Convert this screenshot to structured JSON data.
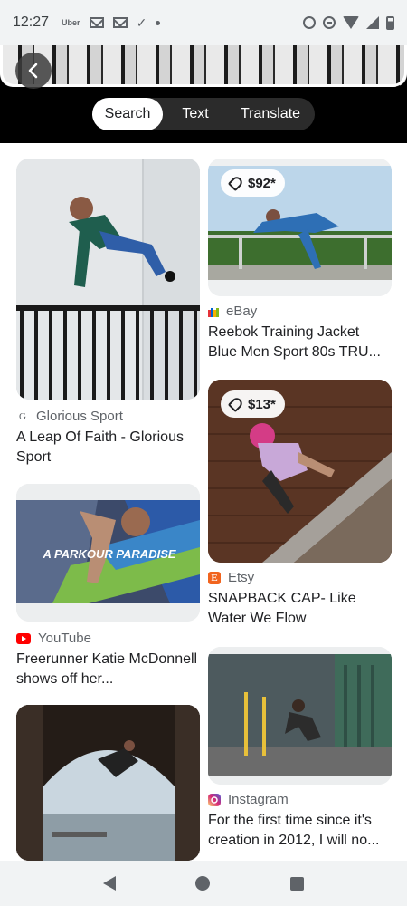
{
  "status_bar": {
    "time": "12:27",
    "uber_label": "Uber",
    "check_glyph": "✓",
    "icons_left": [
      "uber-icon",
      "gmail-icon",
      "gmail-icon",
      "task-check-icon",
      "dot-icon"
    ],
    "icons_right": [
      "alarm-icon",
      "do-not-disturb-icon",
      "wifi-icon",
      "signal-icon",
      "battery-icon"
    ]
  },
  "header": {
    "back_icon": "chevron-left-icon",
    "modes": [
      {
        "label": "Search",
        "active": true
      },
      {
        "label": "Text",
        "active": false
      },
      {
        "label": "Translate",
        "active": false
      }
    ]
  },
  "results": {
    "left": [
      {
        "source": "Glorious Sport",
        "source_icon": "G",
        "title": "A Leap Of Faith - Glorious Sport"
      },
      {
        "source": "YouTube",
        "source_icon": "youtube-icon",
        "overlay_text": "A PARKOUR PARADISE",
        "title": "Freerunner Katie McDonnell shows off her..."
      },
      {
        "source": "",
        "title": ""
      }
    ],
    "right": [
      {
        "price": "$92*",
        "source": "eBay",
        "source_icon": "ebay-icon",
        "title": "Reebok Training Jacket Blue Men Sport 80s TRU..."
      },
      {
        "price": "$13*",
        "source": "Etsy",
        "source_icon": "E",
        "title": "SNAPBACK CAP- Like Water We Flow"
      },
      {
        "source": "Instagram",
        "source_icon": "instagram-icon",
        "title": "For the first time since it's creation in 2012, I will no..."
      }
    ]
  },
  "nav_bar": {
    "buttons": [
      "back-icon",
      "home-icon",
      "recents-icon"
    ]
  },
  "colors": {
    "background": "#ffffff",
    "header": "#000000",
    "pill": "#2b2b2b",
    "youtube": "#ff0000",
    "etsy": "#f1641e",
    "text_secondary": "#5f6368"
  }
}
